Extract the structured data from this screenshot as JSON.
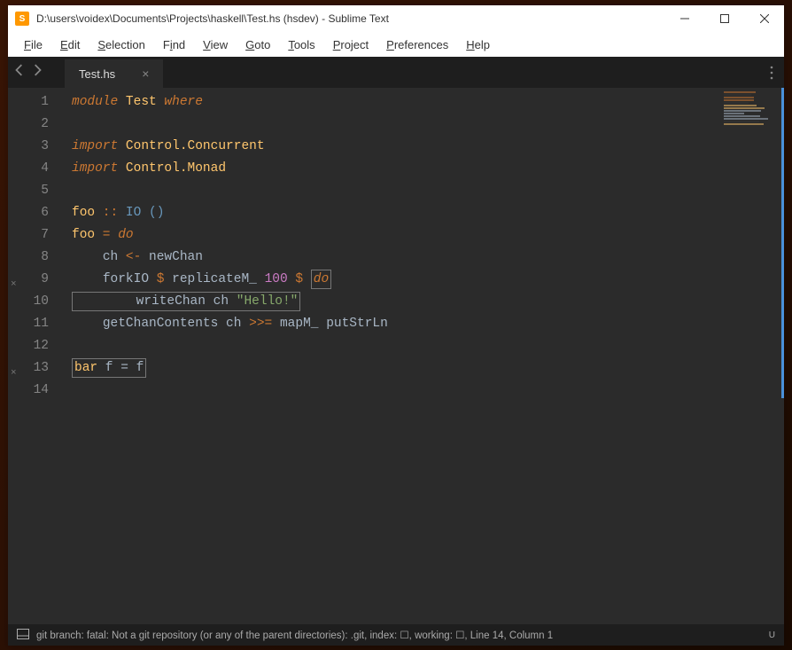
{
  "window": {
    "title": "D:\\users\\voidex\\Documents\\Projects\\haskell\\Test.hs (hsdev) - Sublime Text",
    "app_icon_letter": "S"
  },
  "menu": {
    "items": [
      {
        "label": "File",
        "u": "F",
        "rest": "ile"
      },
      {
        "label": "Edit",
        "u": "E",
        "rest": "dit"
      },
      {
        "label": "Selection",
        "u": "S",
        "rest": "election"
      },
      {
        "label": "Find",
        "u": "F",
        "rest": "ind",
        "uidx": 0
      },
      {
        "label": "View",
        "u": "V",
        "rest": "iew"
      },
      {
        "label": "Goto",
        "u": "G",
        "rest": "oto"
      },
      {
        "label": "Tools",
        "u": "T",
        "rest": "ools"
      },
      {
        "label": "Project",
        "u": "P",
        "rest": "roject"
      },
      {
        "label": "Preferences",
        "u": "P",
        "rest": "references"
      },
      {
        "label": "Help",
        "u": "H",
        "rest": "elp"
      }
    ]
  },
  "tabs": {
    "active": {
      "label": "Test.hs"
    }
  },
  "gutter_marks": [
    {
      "line": 9,
      "mark": "×"
    },
    {
      "line": 13,
      "mark": "×"
    }
  ],
  "code": {
    "lines": [
      {
        "n": 1,
        "tokens": [
          {
            "t": "module ",
            "c": "kw-module"
          },
          {
            "t": "Test",
            "c": "type-name"
          },
          {
            "t": " where",
            "c": "kw-where"
          }
        ]
      },
      {
        "n": 2,
        "tokens": []
      },
      {
        "n": 3,
        "tokens": [
          {
            "t": "import ",
            "c": "kw-import"
          },
          {
            "t": "Control.Concurrent",
            "c": "type-name"
          }
        ]
      },
      {
        "n": 4,
        "tokens": [
          {
            "t": "import ",
            "c": "kw-import"
          },
          {
            "t": "Control.Monad",
            "c": "type-name"
          }
        ]
      },
      {
        "n": 5,
        "tokens": []
      },
      {
        "n": 6,
        "tokens": [
          {
            "t": "foo",
            "c": "func-def"
          },
          {
            "t": " :: ",
            "c": "op"
          },
          {
            "t": "IO",
            "c": "io-type"
          },
          {
            "t": " ",
            "c": ""
          },
          {
            "t": "()",
            "c": "io-type"
          }
        ]
      },
      {
        "n": 7,
        "tokens": [
          {
            "t": "foo",
            "c": "func-def"
          },
          {
            "t": " = ",
            "c": "op"
          },
          {
            "t": "do",
            "c": "kw-do"
          }
        ]
      },
      {
        "n": 8,
        "tokens": [
          {
            "t": "    ",
            "c": ""
          },
          {
            "t": "ch",
            "c": "ident"
          },
          {
            "t": " <- ",
            "c": "op"
          },
          {
            "t": "newChan",
            "c": "ident"
          }
        ]
      },
      {
        "n": 9,
        "tokens": [
          {
            "t": "    ",
            "c": ""
          },
          {
            "t": "forkIO",
            "c": "ident"
          },
          {
            "t": " $ ",
            "c": "op-dollar"
          },
          {
            "t": "replicateM_",
            "c": "ident"
          },
          {
            "t": " ",
            "c": ""
          },
          {
            "t": "100",
            "c": "num"
          },
          {
            "t": " $ ",
            "c": "op-dollar"
          },
          {
            "t": "do",
            "c": "kw-do",
            "box": true
          }
        ]
      },
      {
        "n": 10,
        "tokens": [
          {
            "t": "        ",
            "c": "",
            "boxstart": true
          },
          {
            "t": "writeChan",
            "c": "ident"
          },
          {
            "t": " ",
            "c": ""
          },
          {
            "t": "ch",
            "c": "ident"
          },
          {
            "t": " ",
            "c": ""
          },
          {
            "t": "\"Hello!\"",
            "c": "str",
            "boxend": true
          }
        ],
        "boxed": true
      },
      {
        "n": 11,
        "tokens": [
          {
            "t": "    ",
            "c": ""
          },
          {
            "t": "getChanContents",
            "c": "ident"
          },
          {
            "t": " ",
            "c": ""
          },
          {
            "t": "ch",
            "c": "ident"
          },
          {
            "t": " >>= ",
            "c": "op-bind"
          },
          {
            "t": "mapM_",
            "c": "ident"
          },
          {
            "t": " ",
            "c": ""
          },
          {
            "t": "putStrLn",
            "c": "ident"
          }
        ]
      },
      {
        "n": 12,
        "tokens": []
      },
      {
        "n": 13,
        "tokens": [
          {
            "t": "bar",
            "c": "func-def",
            "box": true,
            "boxgroup": true
          },
          {
            "t": " f = f",
            "c": "ident",
            "box": true,
            "boxgroup": true
          }
        ],
        "boxed_group": true
      },
      {
        "n": 14,
        "tokens": []
      }
    ]
  },
  "statusbar": {
    "text": "git branch: fatal: Not a git repository (or any of the parent directories): .git, index: ☐, working: ☐, Line 14, Column 1",
    "right": "U"
  }
}
